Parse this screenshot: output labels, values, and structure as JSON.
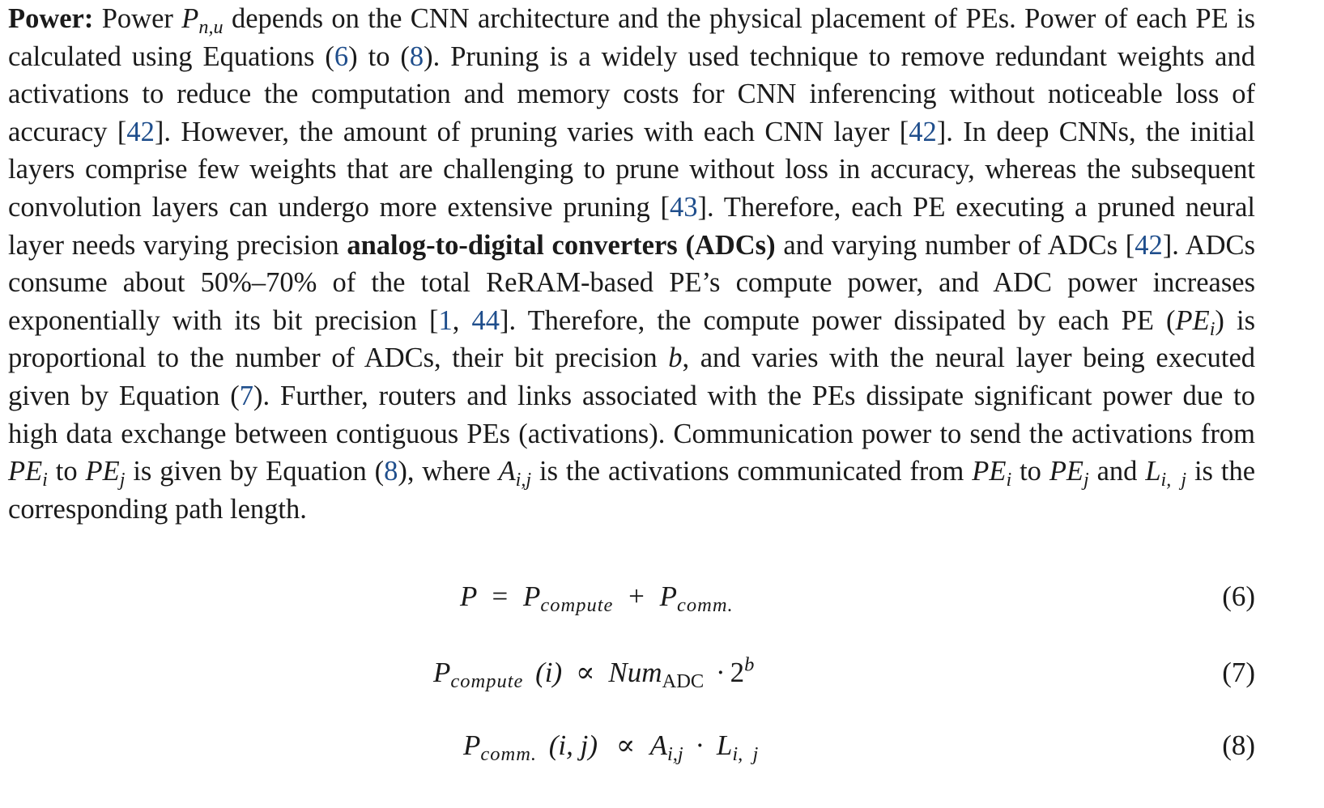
{
  "paragraph": {
    "power_label": "Power:",
    "t_power_p": "Power",
    "p_symbol": "P",
    "p_sub": "n,u",
    "t_depends": "depends on the CNN architecture and the physical placement of PEs. Power of each PE is calculated using Equations (",
    "ref_6": "6",
    "t_to": ") to (",
    "ref_8a": "8",
    "t_pruning": "). Pruning is a widely used technique to remove redundant weights and activations to reduce the computation and memory costs for CNN infer­encing without noticeable loss of accuracy [",
    "ref_42a": "42",
    "t_however": "]. However, the amount of pruning varies with each CNN layer [",
    "ref_42b": "42",
    "t_deep": "]. In deep CNNs, the initial layers comprise few weights that are challenging to prune without loss in accuracy, whereas the subsequent convolution layers can undergo more extensive pruning [",
    "ref_43": "43",
    "t_therefore1": "]. Therefore, each PE executing a pruned neural layer needs varying precision",
    "adc_bold": "analog-to-digital converters (ADCs)",
    "t_varying_num": "and varying number of ADCs [",
    "ref_42c": "42",
    "t_consume": "]. ADCs consume about 50%–70% of the total ReRAM-based PE’s compute power, and ADC power increases exponentially with its bit precision [",
    "ref_1": "1",
    "t_comma": ", ",
    "ref_44": "44",
    "t_therefore2": "]. Therefore, the compute power dissipated by each PE (",
    "pe_i_inline": "PE",
    "pe_i_sub": "i",
    "t_prop": ") is proportional to the number of ADCs, their bit precision",
    "b_sym": "b",
    "t_varies": ", and varies with the neural layer being executed given by Equation (",
    "ref_7": "7",
    "t_further": "). Further, routers and links associated with the PEs dissipate significant power due to high data exchange between contiguous PEs (activations). Communication power to send the activations from",
    "pe": "PE",
    "sub_i": "i",
    "sub_j": "j",
    "t_to_word": "to",
    "t_given": "is given by Equation (",
    "ref_8b": "8",
    "t_where": "), where",
    "a_sym": "A",
    "a_sub": "i,j",
    "t_is_acts": "is the activations communicated from",
    "t_and": "and",
    "l_sym": "L",
    "l_sub": "i, j",
    "t_path": "is the corresponding path length."
  },
  "equations": [
    {
      "lhs": "P",
      "eq": "=",
      "t1": "P",
      "t1_sub": "compute",
      "plus": "+",
      "t2": "P",
      "t2_sub": "comm.",
      "number": "(6)"
    },
    {
      "lhs": "P",
      "lhs_sub": "compute",
      "arg": "(i)",
      "prop": "∝",
      "num": "Num",
      "num_sub": "ADC",
      "dot": "·",
      "base": "2",
      "exp": "b",
      "number": "(7)"
    },
    {
      "lhs": "P",
      "lhs_sub": "comm.",
      "arg": "(i, j)",
      "prop": "∝",
      "a": "A",
      "a_sub": "i,j",
      "dot": "·",
      "l": "L",
      "l_sub": "i, j",
      "number": "(8)"
    }
  ]
}
